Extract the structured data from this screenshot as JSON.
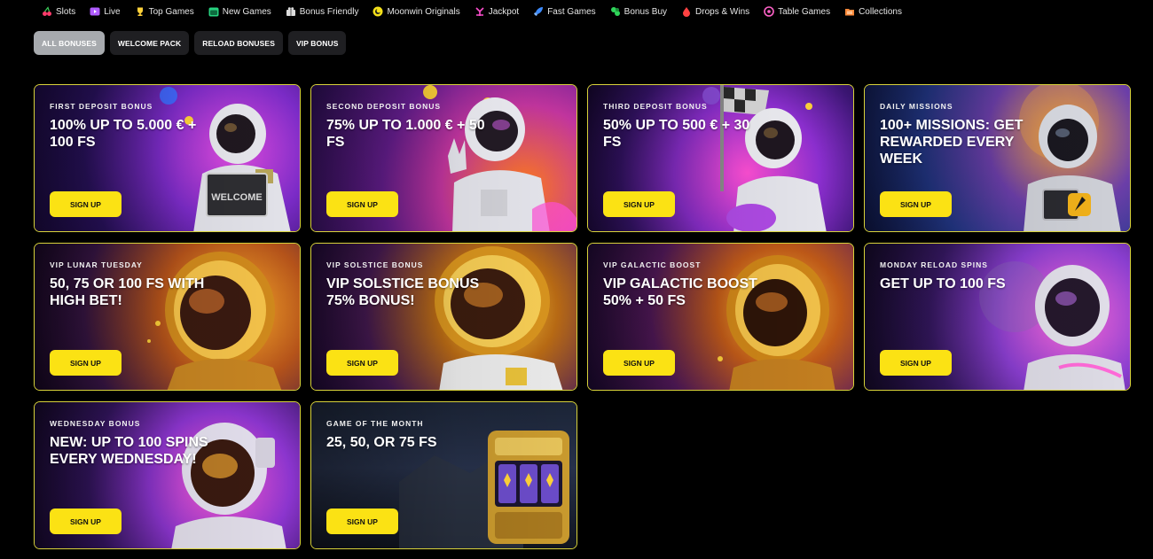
{
  "nav": {
    "categories": [
      {
        "label": "Slots",
        "icon": "cherry-icon",
        "color": "#ff3b6b"
      },
      {
        "label": "Live",
        "icon": "play-icon",
        "color": "#b05cff"
      },
      {
        "label": "Top Games",
        "icon": "trophy-icon",
        "color": "#ffd23a"
      },
      {
        "label": "New Games",
        "icon": "calendar-icon",
        "color": "#27d17f"
      },
      {
        "label": "Bonus Friendly",
        "icon": "gift-icon",
        "color": "#dddddd"
      },
      {
        "label": "Moonwin Originals",
        "icon": "moon-coin-icon",
        "color": "#f4e01a"
      },
      {
        "label": "Jackpot",
        "icon": "slot-machine-icon",
        "color": "#ff4fd0"
      },
      {
        "label": "Fast Games",
        "icon": "rocket-icon",
        "color": "#3d8bff"
      },
      {
        "label": "Bonus Buy",
        "icon": "money-icon",
        "color": "#2fd45a"
      },
      {
        "label": "Drops & Wins",
        "icon": "drop-icon",
        "color": "#ff4242"
      },
      {
        "label": "Table Games",
        "icon": "roulette-icon",
        "color": "#ff62c8"
      },
      {
        "label": "Collections",
        "icon": "folder-icon",
        "color": "#ff8a3a"
      }
    ]
  },
  "filters": [
    {
      "label": "ALL BONUSES",
      "active": true
    },
    {
      "label": "WELCOME PACK",
      "active": false
    },
    {
      "label": "RELOAD BONUSES",
      "active": false
    },
    {
      "label": "VIP BONUS",
      "active": false
    }
  ],
  "cards": [
    {
      "kicker": "FIRST DEPOSIT BONUS",
      "headline": "100% UP TO 5.000 € + 100 FS",
      "cta": "SIGN UP",
      "art": "astronaut-welcome-sign"
    },
    {
      "kicker": "SECOND DEPOSIT BONUS",
      "headline": "75% UP TO 1.000 € + 50 FS",
      "cta": "SIGN UP",
      "art": "astronaut-peace-sign"
    },
    {
      "kicker": "THIRD DEPOSIT BONUS",
      "headline": "50% UP TO 500 € + 30 FS",
      "cta": "SIGN UP",
      "art": "astronaut-flag"
    },
    {
      "kicker": "DAILY MISSIONS",
      "headline": "100+ MISSIONS: GET REWARDED EVERY WEEK",
      "cta": "SIGN UP",
      "art": "astronaut-rocket-badge"
    },
    {
      "kicker": "VIP LUNAR TUESDAY",
      "headline": "50, 75 OR 100 FS WITH HIGH BET!",
      "cta": "SIGN UP",
      "art": "gold-helmet"
    },
    {
      "kicker": "VIP SOLSTICE BONUS",
      "headline": "VIP SOLSTICE BONUS 75% BONUS!",
      "cta": "SIGN UP",
      "art": "gold-helmet"
    },
    {
      "kicker": "VIP GALACTIC BOOST",
      "headline": "VIP GALACTIC BOOST 50% + 50 FS",
      "cta": "SIGN UP",
      "art": "gold-helmet"
    },
    {
      "kicker": "MONDAY RELOAD SPINS",
      "headline": "GET UP TO 100 FS",
      "cta": "SIGN UP",
      "art": "astronaut-purple"
    },
    {
      "kicker": "WEDNESDAY BONUS",
      "headline": "NEW: UP TO 100 SPINS EVERY WEDNESDAY!",
      "cta": "SIGN UP",
      "art": "astronaut-purple"
    },
    {
      "kicker": "GAME OF THE MONTH",
      "headline": "25, 50, OR 75 FS",
      "cta": "SIGN UP",
      "art": "slot-machine"
    }
  ]
}
